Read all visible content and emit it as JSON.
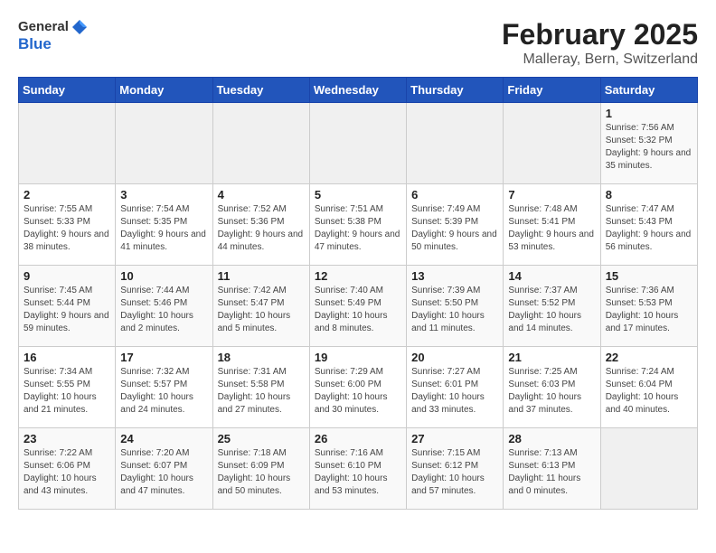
{
  "header": {
    "logo_general": "General",
    "logo_blue": "Blue",
    "month_title": "February 2025",
    "location": "Malleray, Bern, Switzerland"
  },
  "weekdays": [
    "Sunday",
    "Monday",
    "Tuesday",
    "Wednesday",
    "Thursday",
    "Friday",
    "Saturday"
  ],
  "weeks": [
    [
      {
        "day": "",
        "info": ""
      },
      {
        "day": "",
        "info": ""
      },
      {
        "day": "",
        "info": ""
      },
      {
        "day": "",
        "info": ""
      },
      {
        "day": "",
        "info": ""
      },
      {
        "day": "",
        "info": ""
      },
      {
        "day": "1",
        "info": "Sunrise: 7:56 AM\nSunset: 5:32 PM\nDaylight: 9 hours and 35 minutes."
      }
    ],
    [
      {
        "day": "2",
        "info": "Sunrise: 7:55 AM\nSunset: 5:33 PM\nDaylight: 9 hours and 38 minutes."
      },
      {
        "day": "3",
        "info": "Sunrise: 7:54 AM\nSunset: 5:35 PM\nDaylight: 9 hours and 41 minutes."
      },
      {
        "day": "4",
        "info": "Sunrise: 7:52 AM\nSunset: 5:36 PM\nDaylight: 9 hours and 44 minutes."
      },
      {
        "day": "5",
        "info": "Sunrise: 7:51 AM\nSunset: 5:38 PM\nDaylight: 9 hours and 47 minutes."
      },
      {
        "day": "6",
        "info": "Sunrise: 7:49 AM\nSunset: 5:39 PM\nDaylight: 9 hours and 50 minutes."
      },
      {
        "day": "7",
        "info": "Sunrise: 7:48 AM\nSunset: 5:41 PM\nDaylight: 9 hours and 53 minutes."
      },
      {
        "day": "8",
        "info": "Sunrise: 7:47 AM\nSunset: 5:43 PM\nDaylight: 9 hours and 56 minutes."
      }
    ],
    [
      {
        "day": "9",
        "info": "Sunrise: 7:45 AM\nSunset: 5:44 PM\nDaylight: 9 hours and 59 minutes."
      },
      {
        "day": "10",
        "info": "Sunrise: 7:44 AM\nSunset: 5:46 PM\nDaylight: 10 hours and 2 minutes."
      },
      {
        "day": "11",
        "info": "Sunrise: 7:42 AM\nSunset: 5:47 PM\nDaylight: 10 hours and 5 minutes."
      },
      {
        "day": "12",
        "info": "Sunrise: 7:40 AM\nSunset: 5:49 PM\nDaylight: 10 hours and 8 minutes."
      },
      {
        "day": "13",
        "info": "Sunrise: 7:39 AM\nSunset: 5:50 PM\nDaylight: 10 hours and 11 minutes."
      },
      {
        "day": "14",
        "info": "Sunrise: 7:37 AM\nSunset: 5:52 PM\nDaylight: 10 hours and 14 minutes."
      },
      {
        "day": "15",
        "info": "Sunrise: 7:36 AM\nSunset: 5:53 PM\nDaylight: 10 hours and 17 minutes."
      }
    ],
    [
      {
        "day": "16",
        "info": "Sunrise: 7:34 AM\nSunset: 5:55 PM\nDaylight: 10 hours and 21 minutes."
      },
      {
        "day": "17",
        "info": "Sunrise: 7:32 AM\nSunset: 5:57 PM\nDaylight: 10 hours and 24 minutes."
      },
      {
        "day": "18",
        "info": "Sunrise: 7:31 AM\nSunset: 5:58 PM\nDaylight: 10 hours and 27 minutes."
      },
      {
        "day": "19",
        "info": "Sunrise: 7:29 AM\nSunset: 6:00 PM\nDaylight: 10 hours and 30 minutes."
      },
      {
        "day": "20",
        "info": "Sunrise: 7:27 AM\nSunset: 6:01 PM\nDaylight: 10 hours and 33 minutes."
      },
      {
        "day": "21",
        "info": "Sunrise: 7:25 AM\nSunset: 6:03 PM\nDaylight: 10 hours and 37 minutes."
      },
      {
        "day": "22",
        "info": "Sunrise: 7:24 AM\nSunset: 6:04 PM\nDaylight: 10 hours and 40 minutes."
      }
    ],
    [
      {
        "day": "23",
        "info": "Sunrise: 7:22 AM\nSunset: 6:06 PM\nDaylight: 10 hours and 43 minutes."
      },
      {
        "day": "24",
        "info": "Sunrise: 7:20 AM\nSunset: 6:07 PM\nDaylight: 10 hours and 47 minutes."
      },
      {
        "day": "25",
        "info": "Sunrise: 7:18 AM\nSunset: 6:09 PM\nDaylight: 10 hours and 50 minutes."
      },
      {
        "day": "26",
        "info": "Sunrise: 7:16 AM\nSunset: 6:10 PM\nDaylight: 10 hours and 53 minutes."
      },
      {
        "day": "27",
        "info": "Sunrise: 7:15 AM\nSunset: 6:12 PM\nDaylight: 10 hours and 57 minutes."
      },
      {
        "day": "28",
        "info": "Sunrise: 7:13 AM\nSunset: 6:13 PM\nDaylight: 11 hours and 0 minutes."
      },
      {
        "day": "",
        "info": ""
      }
    ]
  ]
}
